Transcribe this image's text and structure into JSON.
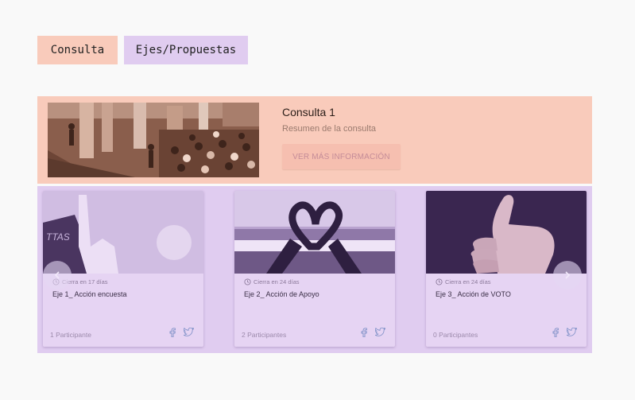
{
  "tabs": [
    {
      "label": "Consulta"
    },
    {
      "label": "Ejes/Propuestas"
    }
  ],
  "consulta": {
    "title": "Consulta 1",
    "summary": "Resumen de la consulta",
    "button_label": "VER MÁS INFORMACIÓN"
  },
  "cards": [
    {
      "closing": "Cierra en 17 días",
      "title": "Eje 1_ Acción encuesta",
      "participants": "1 Participante"
    },
    {
      "closing": "Cierra en 24 días",
      "title": "Eje 2_ Acción de Apoyo",
      "participants": "2 Participantes"
    },
    {
      "closing": "Cierra en 24 días",
      "title": "Eje 3_ Acción de VOTO",
      "participants": "0 Participantes"
    }
  ],
  "icons": {
    "facebook": "facebook-icon",
    "twitter": "twitter-icon",
    "clock": "clock-icon",
    "prev": "chevron-left-icon",
    "next": "chevron-right-icon"
  },
  "colors": {
    "consulta_bg": "#f9cbbb",
    "ejes_bg": "#e0ccf0",
    "card_bg": "#e6d4f3",
    "button_bg": "#f6bfb0",
    "button_text": "#c58c98",
    "social": "#7b8ec6"
  }
}
